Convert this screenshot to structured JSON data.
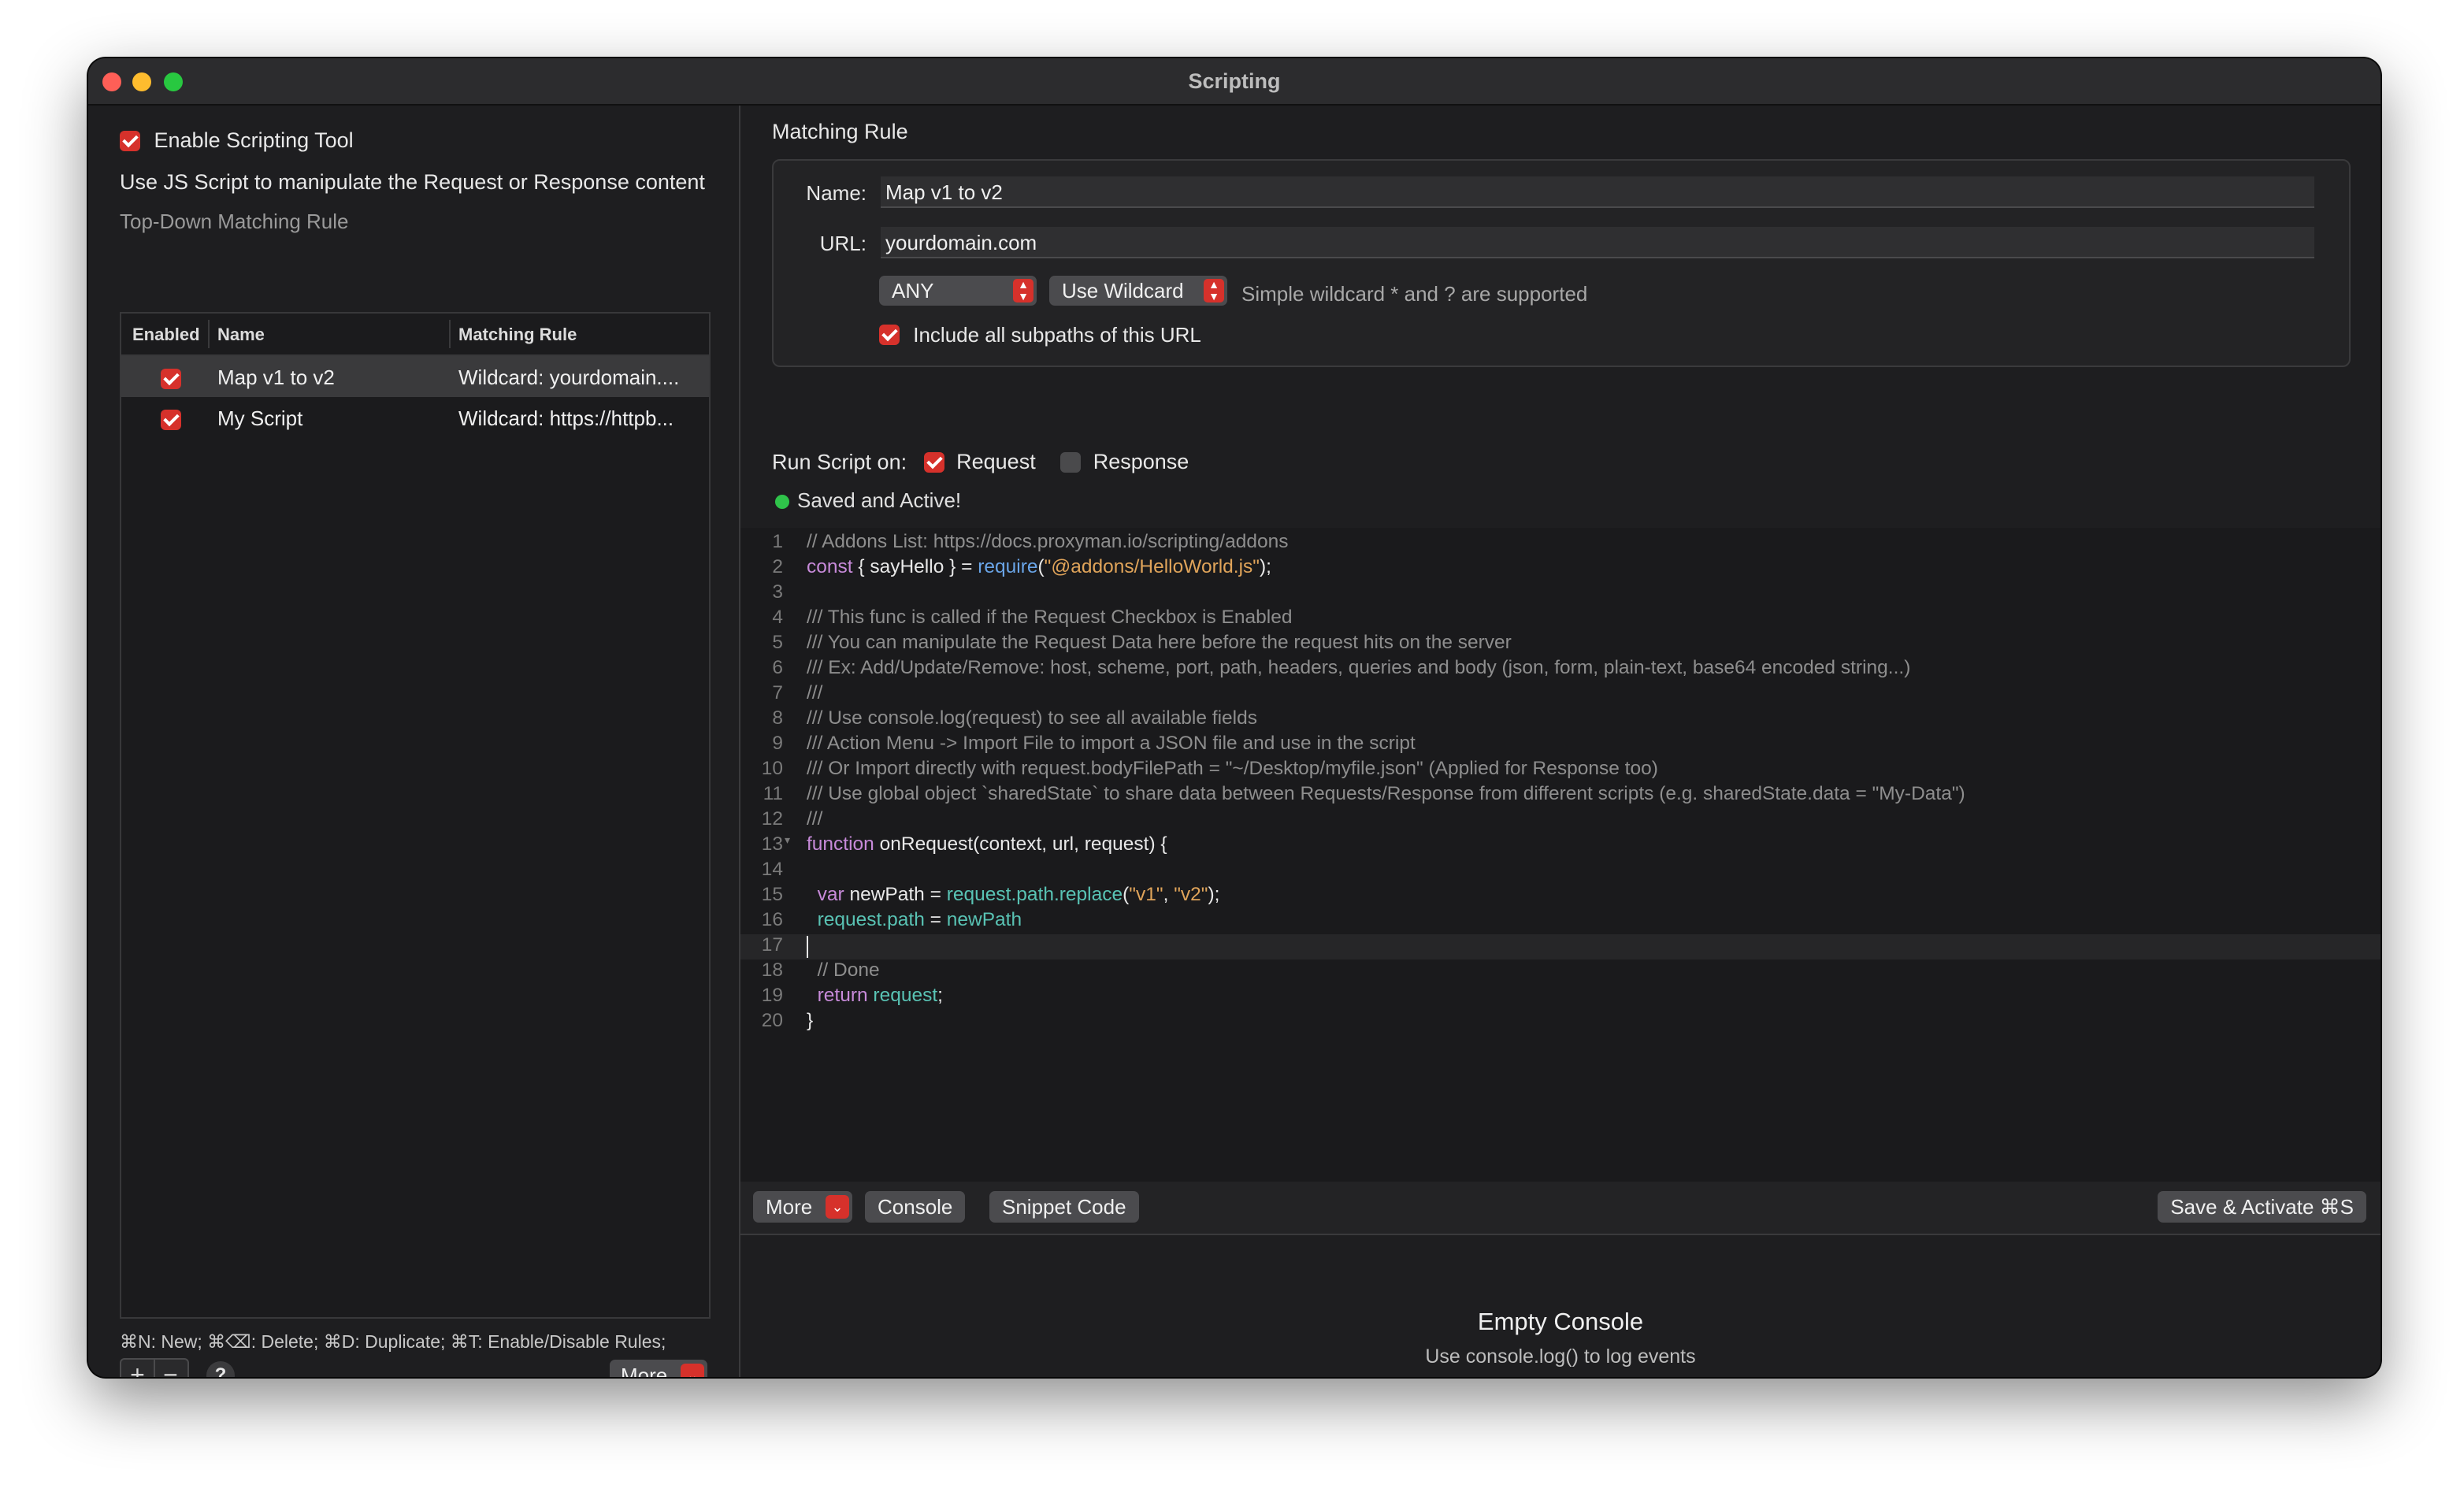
{
  "window": {
    "title": "Scripting"
  },
  "left": {
    "enable_label": "Enable Scripting Tool",
    "description": "Use JS Script to manipulate the Request or Response content",
    "section_label": "Top-Down Matching Rule",
    "columns": [
      "Enabled",
      "Name",
      "Matching Rule"
    ],
    "rows": [
      {
        "enabled": true,
        "name": "Map v1 to v2",
        "rule": "Wildcard: yourdomain...."
      },
      {
        "enabled": true,
        "name": "My Script",
        "rule": "Wildcard: https://httpb..."
      }
    ],
    "shortcuts_hint": "⌘N: New; ⌘⌫: Delete; ⌘D: Duplicate; ⌘T: Enable/Disable Rules;",
    "add_label": "+",
    "remove_label": "−",
    "help_label": "?",
    "more_label": "More"
  },
  "rule": {
    "section_title": "Matching Rule",
    "name_label": "Name:",
    "name_value": "Map v1 to v2",
    "url_label": "URL:",
    "url_value": "yourdomain.com",
    "method_value": "ANY",
    "match_type_value": "Use Wildcard",
    "wildcard_note": "Simple wildcard * and ? are supported",
    "subpaths_label": "Include all subpaths of this URL"
  },
  "run": {
    "label": "Run Script on:",
    "request_label": "Request",
    "request_checked": true,
    "response_label": "Response",
    "response_checked": false,
    "status": "Saved and Active!"
  },
  "editor": {
    "line_numbers": [
      "1",
      "2",
      "3",
      "4",
      "5",
      "6",
      "7",
      "8",
      "9",
      "10",
      "11",
      "12",
      "13",
      "14",
      "15",
      "16",
      "17",
      "18",
      "19",
      "20"
    ],
    "lines": {
      "l1": "// Addons List: https://docs.proxyman.io/scripting/addons",
      "l2_kw": "const",
      "l2_a": " { sayHello } = ",
      "l2_fn": "require",
      "l2_b": "(",
      "l2_str": "\"@addons/HelloWorld.js\"",
      "l2_c": ");",
      "l4": "/// This func is called if the Request Checkbox is Enabled",
      "l5": "/// You can manipulate the Request Data here before the request hits on the server",
      "l6": "/// Ex: Add/Update/Remove: host, scheme, port, path, headers, queries and body (json, form, plain-text, base64 encoded string...)",
      "l7": "///",
      "l8": "/// Use console.log(request) to see all available fields",
      "l9": "/// Action Menu -> Import File to import a JSON file and use in the script",
      "l10": "/// Or Import directly with request.bodyFilePath = \"~/Desktop/myfile.json\" (Applied for Response too)",
      "l11": "/// Use global object `sharedState` to share data between Requests/Response from different scripts (e.g. sharedState.data = \"My-Data\")",
      "l12": "///",
      "l13_kw": "function",
      "l13_a": " onRequest(context, url, request) {",
      "l15_kw": "  var",
      "l15_a": " newPath = ",
      "l15_var": "request.path.replace",
      "l15_b": "(",
      "l15_s1": "\"v1\"",
      "l15_c": ", ",
      "l15_s2": "\"v2\"",
      "l15_d": ");",
      "l16_var": "  request.path",
      "l16_a": " = ",
      "l16_var2": "newPath",
      "l18": "  // Done",
      "l19_kw": "  return",
      "l19_var": " request",
      "l19_a": ";",
      "l20": "}"
    }
  },
  "toolbar": {
    "more_label": "More",
    "console_label": "Console",
    "snippet_label": "Snippet Code",
    "save_label": "Save & Activate ⌘S"
  },
  "console": {
    "title": "Empty Console",
    "subtitle": "Use console.log() to log events"
  },
  "colors": {
    "accent": "#d6312b",
    "status_ok": "#2fc34a"
  }
}
